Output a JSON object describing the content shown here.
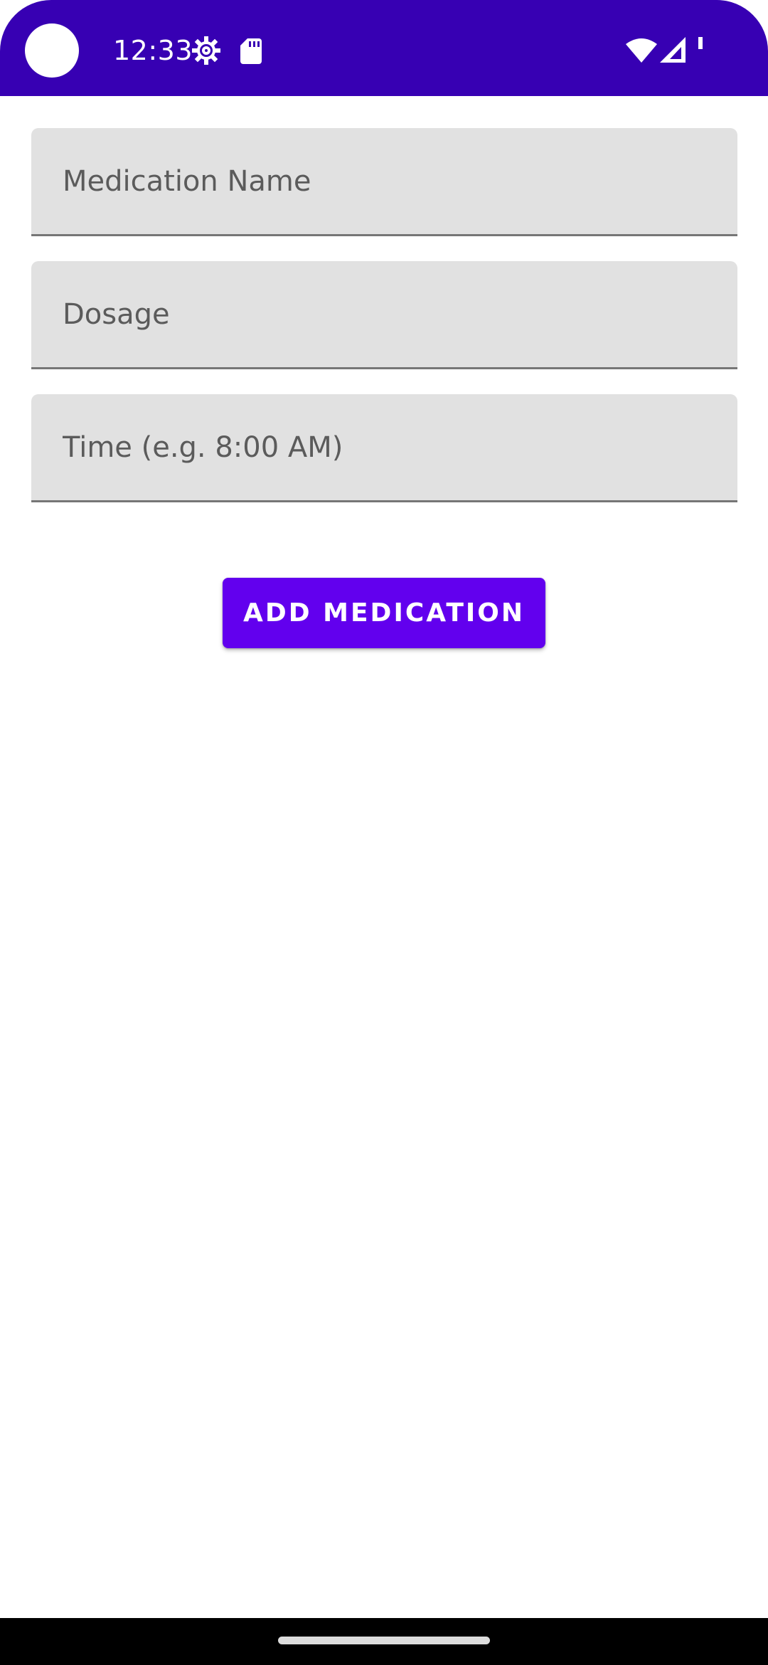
{
  "status_bar": {
    "time": "12:33",
    "background": "#3700b3",
    "icons": [
      "gear-icon",
      "sd-card-icon",
      "wifi-icon",
      "signal-icon",
      "battery-icon"
    ]
  },
  "form": {
    "medication_name": {
      "placeholder": "Medication Name",
      "value": ""
    },
    "dosage": {
      "placeholder": "Dosage",
      "value": ""
    },
    "time": {
      "placeholder": "Time (e.g. 8:00 AM)",
      "value": ""
    }
  },
  "actions": {
    "add_medication_label": "ADD MEDICATION",
    "accent": "#6200ee"
  }
}
